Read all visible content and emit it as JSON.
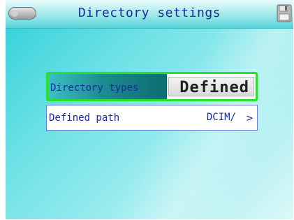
{
  "header": {
    "title": "Directory settings",
    "back_icon": "back-pill-icon",
    "save_icon": "floppy-disk-icon"
  },
  "settings": [
    {
      "label": "Directory types",
      "value": "Defined"
    },
    {
      "label": "Defined path",
      "value": "DCIM/",
      "chevron": ">"
    }
  ],
  "colors": {
    "background": "#6fe2e6",
    "selection_border": "#28e028",
    "text": "#1b2aa0"
  }
}
